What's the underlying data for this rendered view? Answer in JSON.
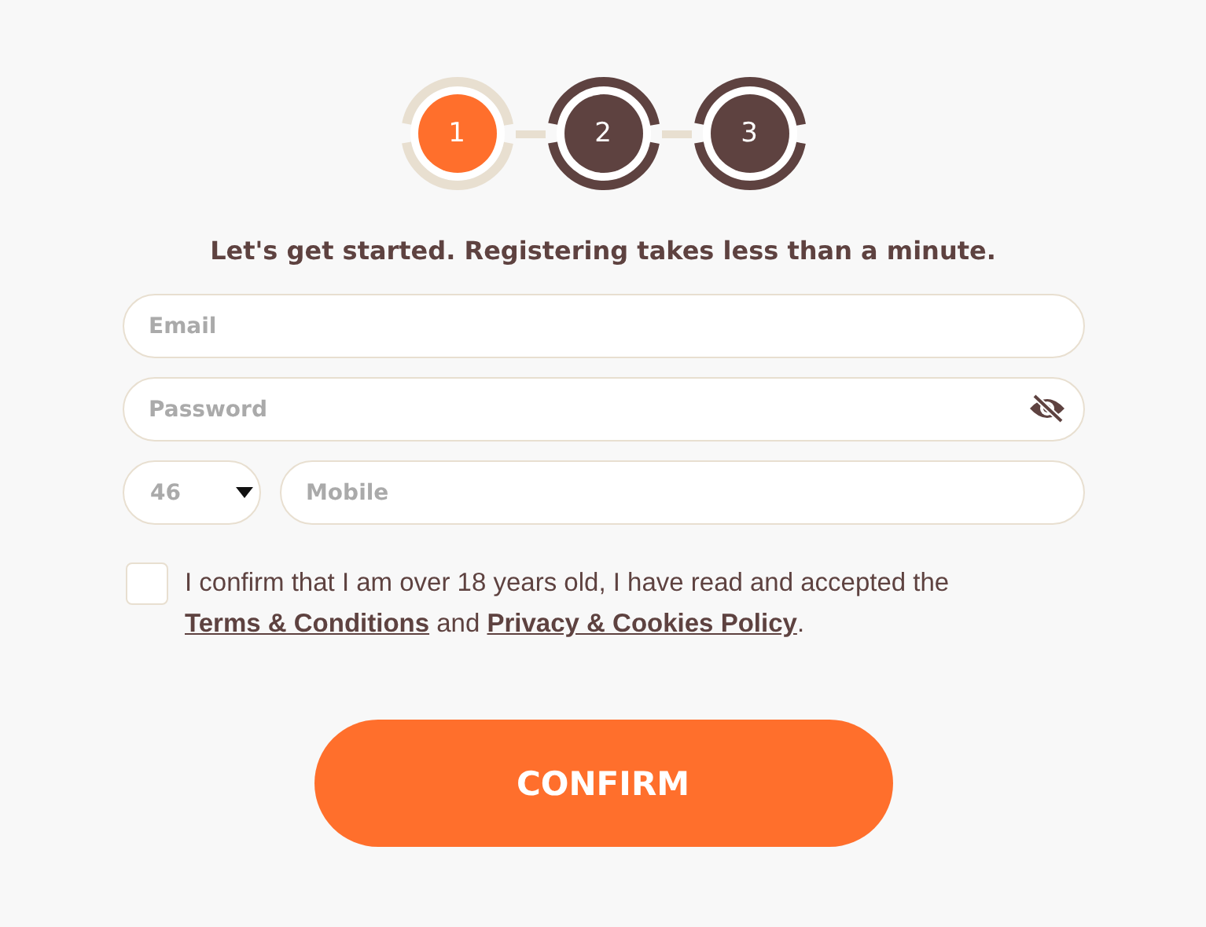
{
  "steps": [
    {
      "label": "1",
      "selected": true
    },
    {
      "label": "2",
      "selected": false
    },
    {
      "label": "3",
      "selected": false
    }
  ],
  "heading": "Let's get started. Registering takes less than a minute.",
  "email": {
    "placeholder": "Email"
  },
  "password": {
    "placeholder": "Password"
  },
  "country_code": {
    "value": "46"
  },
  "mobile": {
    "placeholder": "Mobile"
  },
  "consent": {
    "checked": false,
    "parts": [
      {
        "kind": "text",
        "text": "I confirm that I am over 18 years old, I have read and accepted the "
      },
      {
        "kind": "link",
        "text": "Terms & Conditions"
      },
      {
        "kind": "text",
        "text": " and "
      },
      {
        "kind": "link",
        "text": "Privacy & Cookies Policy"
      },
      {
        "kind": "text",
        "text": "."
      }
    ]
  },
  "confirm_button": "CONFIRM"
}
